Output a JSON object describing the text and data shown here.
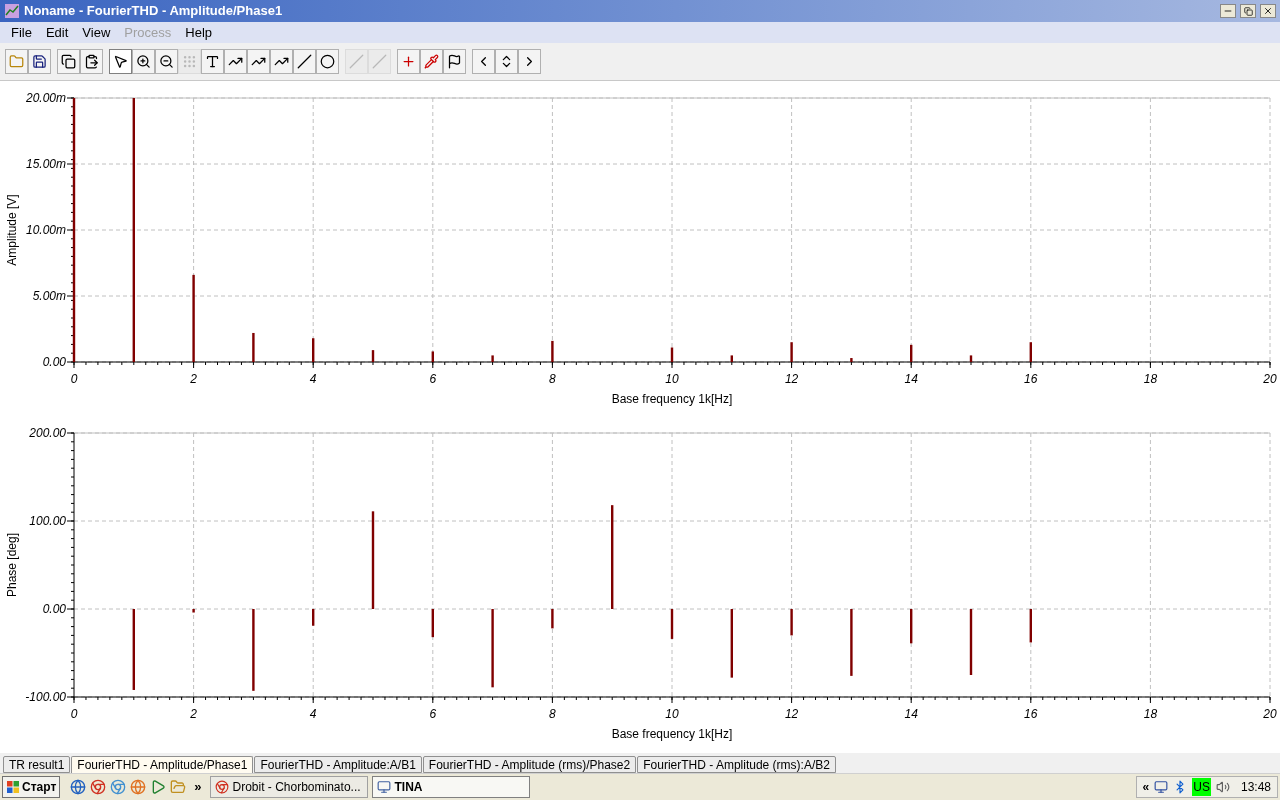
{
  "window": {
    "title": "Noname - FourierTHD - Amplitude/Phase1"
  },
  "menu": [
    {
      "label": "File",
      "disabled": false
    },
    {
      "label": "Edit",
      "disabled": false
    },
    {
      "label": "View",
      "disabled": false
    },
    {
      "label": "Process",
      "disabled": true
    },
    {
      "label": "Help",
      "disabled": false
    }
  ],
  "toolbar": [
    [
      {
        "kind": "open",
        "selected": false,
        "disabled": false
      },
      {
        "kind": "save",
        "selected": false,
        "disabled": false
      }
    ],
    [
      {
        "kind": "copy",
        "selected": false,
        "disabled": false
      },
      {
        "kind": "paste",
        "selected": false,
        "disabled": false
      }
    ],
    [
      {
        "kind": "pointer",
        "selected": true,
        "disabled": false
      },
      {
        "kind": "zoom-in",
        "selected": false,
        "disabled": false
      },
      {
        "kind": "zoom-out",
        "selected": false,
        "disabled": false
      },
      {
        "kind": "grid",
        "selected": false,
        "disabled": true
      },
      {
        "kind": "text",
        "selected": false,
        "disabled": false
      },
      {
        "kind": "label-curve",
        "selected": false,
        "disabled": false
      },
      {
        "kind": "label-curve",
        "selected": false,
        "disabled": false
      },
      {
        "kind": "legend-curve",
        "selected": false,
        "disabled": false
      },
      {
        "kind": "line",
        "selected": false,
        "disabled": false
      },
      {
        "kind": "circle",
        "selected": false,
        "disabled": false
      }
    ],
    [
      {
        "kind": "line",
        "selected": false,
        "disabled": true
      },
      {
        "kind": "line",
        "selected": false,
        "disabled": true
      }
    ],
    [
      {
        "kind": "add-curve",
        "selected": false,
        "disabled": false
      },
      {
        "kind": "add-marker",
        "selected": false,
        "disabled": false
      },
      {
        "kind": "flag",
        "selected": false,
        "disabled": false
      }
    ],
    [
      {
        "kind": "left",
        "selected": false,
        "disabled": false
      },
      {
        "kind": "updown",
        "selected": false,
        "disabled": false
      },
      {
        "kind": "right",
        "selected": false,
        "disabled": false
      }
    ]
  ],
  "charts": [
    {
      "chart_data": {
        "type": "bar",
        "xlabel": "Base frequency 1k[Hz]",
        "ylabel": "Amplitude [V]",
        "grid": true,
        "x": [
          0,
          1,
          2,
          3,
          4,
          5,
          6,
          7,
          8,
          10,
          11,
          12,
          13,
          14,
          15,
          16
        ],
        "series": [
          {
            "color": "#800000",
            "values": [
              20,
              20,
              6.6,
              2.2,
              1.8,
              0.9,
              0.8,
              0.5,
              1.6,
              1.1,
              0.5,
              1.5,
              0.3,
              1.3,
              0.5,
              1.5
            ]
          }
        ],
        "xlim": [
          0,
          20
        ],
        "ylim": [
          0,
          20
        ],
        "xticks": [
          0,
          2,
          4,
          6,
          8,
          10,
          12,
          14,
          16,
          18,
          20
        ],
        "yticks": [
          {
            "value": 0,
            "label": "0.00"
          },
          {
            "value": 5,
            "label": "5.00m"
          },
          {
            "value": 10,
            "label": "10.00m"
          },
          {
            "value": 15,
            "label": "15.00m"
          },
          {
            "value": 20,
            "label": "20.00m"
          }
        ]
      }
    },
    {
      "chart_data": {
        "type": "bar",
        "xlabel": "Base frequency 1k[Hz]",
        "ylabel": "Phase [deg]",
        "grid": true,
        "x": [
          1,
          2,
          3,
          4,
          5,
          6,
          7,
          8,
          9,
          10,
          11,
          12,
          13,
          14,
          15,
          16
        ],
        "series": [
          {
            "color": "#800000",
            "values": [
              -92,
              -4,
              -93,
              -19,
              111,
              -32,
              -89,
              -22,
              118,
              -34,
              -78,
              -30,
              -76,
              -39,
              -75,
              -38
            ]
          }
        ],
        "xlim": [
          0,
          20
        ],
        "ylim": [
          -100,
          200
        ],
        "xticks": [
          0,
          2,
          4,
          6,
          8,
          10,
          12,
          14,
          16,
          18,
          20
        ],
        "yticks": [
          {
            "value": -100,
            "label": "-100.00"
          },
          {
            "value": 0,
            "label": "0.00"
          },
          {
            "value": 100,
            "label": "100.00"
          },
          {
            "value": 200,
            "label": "200.00"
          }
        ]
      }
    }
  ],
  "tabs": [
    {
      "label": "TR result1",
      "selected": false
    },
    {
      "label": "FourierTHD - Amplitude/Phase1",
      "selected": true
    },
    {
      "label": "FourierTHD - Amplitude:A/B1",
      "selected": false
    },
    {
      "label": "FourierTHD - Amplitude (rms)/Phase2",
      "selected": false
    },
    {
      "label": "FourierTHD - Amplitude (rms):A/B2",
      "selected": false
    }
  ],
  "taskbar": {
    "start": "Старт",
    "more": "»",
    "tasks": [
      {
        "label": "Drobit - Chorbominato...",
        "selected": false
      },
      {
        "label": "TINA",
        "selected": true
      }
    ],
    "tray_expand": "«",
    "keyboard": "US",
    "clock": "13:48"
  }
}
